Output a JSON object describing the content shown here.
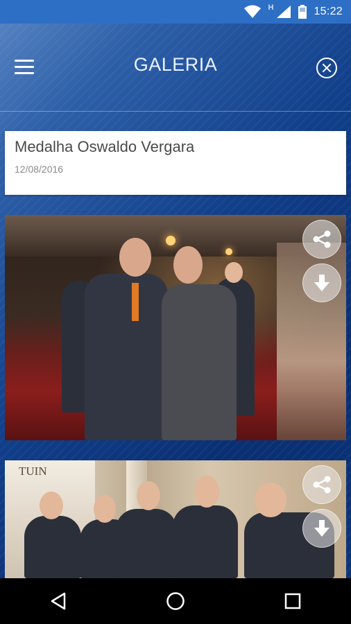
{
  "status_bar": {
    "network_letter": "H",
    "time": "15:22",
    "icons": [
      "wifi-icon",
      "signal-icon",
      "battery-icon"
    ]
  },
  "header": {
    "title": "GALERIA",
    "menu_icon": "hamburger-menu-icon",
    "close_icon": "close-circle-icon"
  },
  "album": {
    "title": "Medalha Oswaldo Vergara",
    "date": "12/08/2016"
  },
  "photos": [
    {
      "actions": [
        "share-icon",
        "download-icon"
      ]
    },
    {
      "store_sign": "TUIN",
      "actions": [
        "share-icon",
        "download-icon"
      ]
    }
  ],
  "nav_bar": {
    "buttons": [
      "back-icon",
      "home-icon",
      "recents-icon"
    ]
  },
  "colors": {
    "status_bar": "#2e6fc6",
    "background_dark": "#0b2d6b",
    "nav_bar": "#000000"
  }
}
